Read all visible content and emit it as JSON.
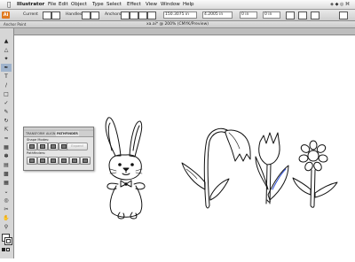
{
  "menubar": {
    "app": "Illustrator",
    "items": [
      "File",
      "Edit",
      "Object",
      "Type",
      "Select",
      "Effect",
      "View",
      "Window",
      "Help"
    ]
  },
  "controlbar": {
    "logo": "Ai",
    "current_label": "Current",
    "handles_label": "Handles",
    "anchors_label": "Anchors",
    "x_value": "150.3075 in",
    "y_value": "4.2005 in",
    "w_value": "0 in",
    "h_value": "0 in"
  },
  "secondbar": {
    "tool_label": "Anchor Point",
    "document_title": "xa.ai* @ 200% (CMYK/Preview)"
  },
  "pathfinder": {
    "tabs": [
      "TRANSFORM",
      "ALIGN",
      "PATHFINDER"
    ],
    "shape_modes_label": "Shape Modes:",
    "pathfinders_label": "Pathfinders:",
    "expand_label": "Expand"
  },
  "icons": [
    "apple-icon",
    "selection-tool-icon",
    "direct-selection-tool-icon",
    "pen-tool-icon",
    "type-tool-icon",
    "brush-tool-icon",
    "pencil-tool-icon",
    "rotate-tool-icon",
    "scale-tool-icon",
    "gradient-tool-icon",
    "eyedropper-tool-icon",
    "zoom-tool-icon"
  ]
}
